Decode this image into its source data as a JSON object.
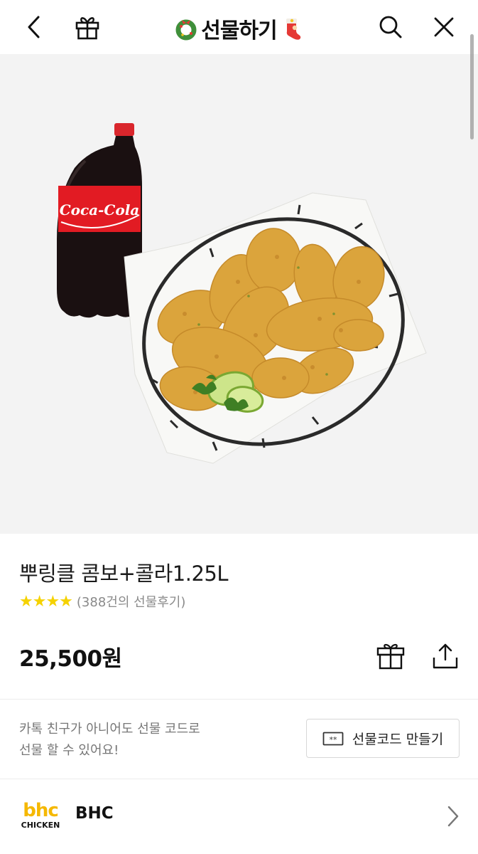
{
  "header": {
    "title": "선물하기",
    "left_icons": [
      "back-icon",
      "gift-box-icon"
    ],
    "right_icons": [
      "search-icon",
      "close-icon"
    ],
    "decorations": [
      "wreath-icon",
      "christmas-stocking-icon"
    ]
  },
  "product": {
    "name": "뿌링클 콤보+콜라1.25L",
    "rating_stars": 4,
    "review_text": "(388건의 선물후기)",
    "price": "25,500원",
    "image_labels": {
      "bottle_brand": "Coca-Cola"
    }
  },
  "gift_code": {
    "line1": "카톡 친구가 아니어도 선물 코드로",
    "line2": "선물 할 수 있어요!",
    "button_label": "선물코드 만들기"
  },
  "brand": {
    "logo_top": "bhc",
    "logo_bottom": "CHICKEN",
    "name": "BHC"
  },
  "colors": {
    "accent_star": "#f5d200",
    "hero_bg": "#f3f3f3",
    "bhc_yellow": "#f5b800"
  }
}
